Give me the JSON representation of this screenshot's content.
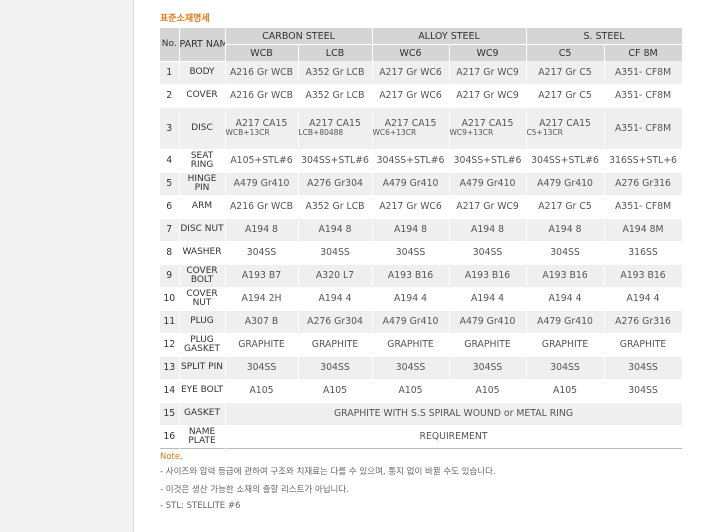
{
  "section_title": "표준소재명세",
  "table": {
    "header": {
      "no": "No.",
      "part": "PART NAME",
      "groups": [
        "CARBON STEEL",
        "ALLOY STEEL",
        "S. STEEL"
      ],
      "grades": [
        "WCB",
        "LCB",
        "WC6",
        "WC9",
        "C5",
        "CF 8M"
      ]
    },
    "rows": [
      {
        "no": "1",
        "part": "BODY",
        "cells": [
          "A216 Gr WCB",
          "A352 Gr LCB",
          "A217 Gr WC6",
          "A217 Gr WC9",
          "A217 Gr C5",
          "A351- CF8M"
        ]
      },
      {
        "no": "2",
        "part": "COVER",
        "cells": [
          "A216 Gr WCB",
          "A352 Gr LCB",
          "A217 Gr WC6",
          "A217 Gr WC9",
          "A217 Gr C5",
          "A351- CF8M"
        ]
      },
      {
        "no": "3",
        "part": "DISC",
        "cells": [
          {
            "top": "A217 CA15",
            "bot": "WCB+13CR"
          },
          {
            "top": "A217 CA15",
            "bot": "LCB+80488"
          },
          {
            "top": "A217 CA15",
            "bot": "WC6+13CR"
          },
          {
            "top": "A217 CA15",
            "bot": "WC9+13CR"
          },
          {
            "top": "A217 CA15",
            "bot": "C5+13CR"
          },
          "A351- CF8M"
        ]
      },
      {
        "no": "4",
        "part": "SEAT RING",
        "cells": [
          "A105+STL#6",
          "304SS+STL#6",
          "304SS+STL#6",
          "304SS+STL#6",
          "304SS+STL#6",
          "316SS+STL+6"
        ]
      },
      {
        "no": "5",
        "part": "HINGE PIN",
        "cells": [
          "A479 Gr410",
          "A276 Gr304",
          "A479 Gr410",
          "A479 Gr410",
          "A479 Gr410",
          "A276 Gr316"
        ]
      },
      {
        "no": "6",
        "part": "ARM",
        "cells": [
          "A216 Gr WCB",
          "A352 Gr LCB",
          "A217 Gr WC6",
          "A217 Gr WC9",
          "A217 Gr C5",
          "A351- CF8M"
        ]
      },
      {
        "no": "7",
        "part": "DISC NUT",
        "cells": [
          "A194 8",
          "A194 8",
          "A194 8",
          "A194 8",
          "A194 8",
          "A194 8M"
        ]
      },
      {
        "no": "8",
        "part": "WASHER",
        "cells": [
          "304SS",
          "304SS",
          "304SS",
          "304SS",
          "304SS",
          "316SS"
        ]
      },
      {
        "no": "9",
        "part": "COVER BOLT",
        "cells": [
          "A193 B7",
          "A320 L7",
          "A193 B16",
          "A193 B16",
          "A193 B16",
          "A193 B16"
        ]
      },
      {
        "no": "10",
        "part": "COVER NUT",
        "cells": [
          "A194 2H",
          "A194 4",
          "A194 4",
          "A194 4",
          "A194 4",
          "A194 4"
        ]
      },
      {
        "no": "11",
        "part": "PLUG",
        "cells": [
          "A307 B",
          "A276 Gr304",
          "A479 Gr410",
          "A479 Gr410",
          "A479 Gr410",
          "A276 Gr316"
        ]
      },
      {
        "no": "12",
        "part": "PLUG GASKET",
        "cells": [
          "GRAPHITE",
          "GRAPHITE",
          "GRAPHITE",
          "GRAPHITE",
          "GRAPHITE",
          "GRAPHITE"
        ]
      },
      {
        "no": "13",
        "part": "SPLIT PIN",
        "cells": [
          "304SS",
          "304SS",
          "304SS",
          "304SS",
          "304SS",
          "304SS"
        ]
      },
      {
        "no": "14",
        "part": "EYE BOLT",
        "cells": [
          "A105",
          "A105",
          "A105",
          "A105",
          "A105",
          "304SS"
        ]
      },
      {
        "no": "15",
        "part": "GASKET",
        "span": "GRAPHITE WITH S.S SPIRAL WOUND or METAL RING"
      },
      {
        "no": "16",
        "part": "NAME PLATE",
        "span": "REQUIREMENT"
      }
    ]
  },
  "notes": {
    "title": "Note.",
    "lines": [
      "- 사이즈와 압력 등급에 관하여 구조와 치재료는 다를 수 있으며, 통지 없이 바뀔 수도 있습니다.",
      "- 이것은 생산 가능한 소재의 출할 리스트가 아닙니다.",
      "- STL: STELLITE #6"
    ]
  },
  "colors": {
    "accent": "#e07b1a",
    "header_bg": "#d5d5d5",
    "row_shade": "#efefef"
  }
}
